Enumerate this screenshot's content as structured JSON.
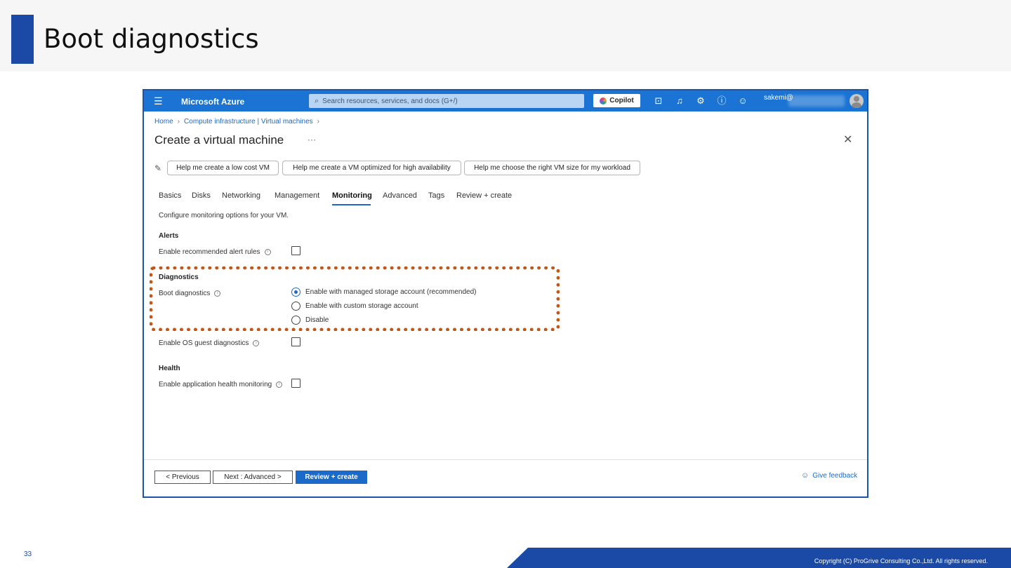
{
  "slide": {
    "title": "Boot diagnostics",
    "page_number": "33",
    "copyright": "Copyright (C) ProGrive Consulting Co.,Ltd. All rights reserved."
  },
  "topbar": {
    "menu_icon": "hamburger-icon",
    "brand": "Microsoft Azure",
    "search_placeholder": "Search resources, services, and docs (G+/)",
    "copilot_label": "Copilot",
    "icons": [
      "terminal-icon",
      "bell-icon",
      "gear-icon",
      "help-icon",
      "feedback-icon"
    ],
    "user": "sakemi@"
  },
  "breadcrumb": [
    "Home",
    "Compute infrastructure | Virtual machines"
  ],
  "page": {
    "title": "Create a virtual machine",
    "more": "···",
    "close": "✕"
  },
  "suggestions": [
    "Help me create a low cost VM",
    "Help me create a VM optimized for high availability",
    "Help me choose the right VM size for my workload"
  ],
  "tabs": [
    "Basics",
    "Disks",
    "Networking",
    "Management",
    "Monitoring",
    "Advanced",
    "Tags",
    "Review + create"
  ],
  "active_tab": "Monitoring",
  "description": "Configure monitoring options for your VM.",
  "alerts": {
    "heading": "Alerts",
    "recommended_label": "Enable recommended alert rules",
    "recommended_checked": false
  },
  "diagnostics": {
    "heading": "Diagnostics",
    "boot_label": "Boot diagnostics",
    "options": [
      "Enable with managed storage account (recommended)",
      "Enable with custom storage account",
      "Disable"
    ],
    "selected": "Enable with managed storage account (recommended)",
    "os_guest_label": "Enable OS guest diagnostics",
    "os_guest_checked": false
  },
  "health": {
    "heading": "Health",
    "app_health_label": "Enable application health monitoring",
    "app_health_checked": false
  },
  "footer": {
    "previous": "< Previous",
    "next": "Next : Advanced >",
    "review": "Review + create",
    "feedback": "Give feedback"
  },
  "colors": {
    "azure_blue": "#1b74d3",
    "slide_blue": "#1a4aa5",
    "highlight": "#c2571a"
  }
}
